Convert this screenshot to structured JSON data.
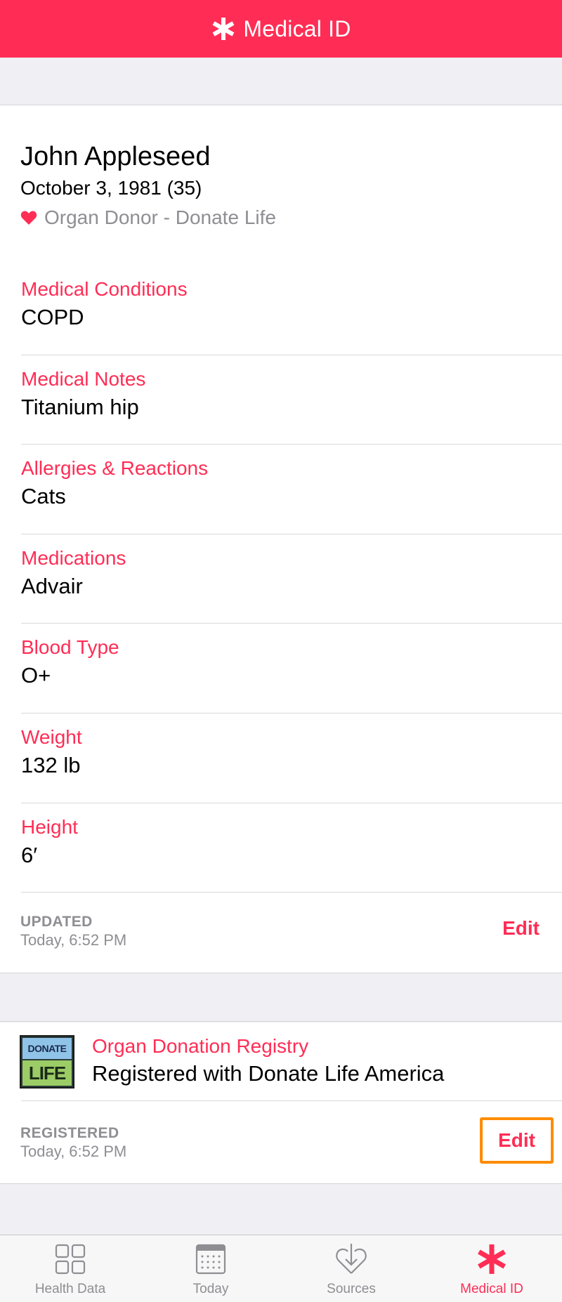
{
  "nav": {
    "title": "Medical ID",
    "icon": "asterisk-icon"
  },
  "profile": {
    "name": "John Appleseed",
    "dob": "October 3, 1981 (35)",
    "donor_status": "Organ Donor - Donate Life"
  },
  "fields": [
    {
      "label": "Medical Conditions",
      "value": "COPD"
    },
    {
      "label": "Medical Notes",
      "value": "Titanium hip"
    },
    {
      "label": "Allergies & Reactions",
      "value": "Cats"
    },
    {
      "label": "Medications",
      "value": "Advair"
    },
    {
      "label": "Blood Type",
      "value": "O+"
    },
    {
      "label": "Weight",
      "value": "132 lb"
    },
    {
      "label": "Height",
      "value": "6′"
    }
  ],
  "updated": {
    "caption": "UPDATED",
    "time": "Today, 6:52 PM",
    "edit_label": "Edit"
  },
  "registry": {
    "logo_top": "DONATE",
    "logo_bottom": "LIFE",
    "label": "Organ Donation Registry",
    "value": "Registered with Donate Life America",
    "caption": "REGISTERED",
    "time": "Today, 6:52 PM",
    "edit_label": "Edit"
  },
  "tabs": [
    {
      "label": "Health Data",
      "icon": "grid-icon",
      "active": false
    },
    {
      "label": "Today",
      "icon": "calendar-icon",
      "active": false
    },
    {
      "label": "Sources",
      "icon": "heart-download-icon",
      "active": false
    },
    {
      "label": "Medical ID",
      "icon": "asterisk-icon",
      "active": true
    }
  ],
  "colors": {
    "accent": "#ff2d55",
    "highlight": "#ff8c00",
    "secondary_text": "#8e8e93",
    "background": "#efeff4"
  }
}
